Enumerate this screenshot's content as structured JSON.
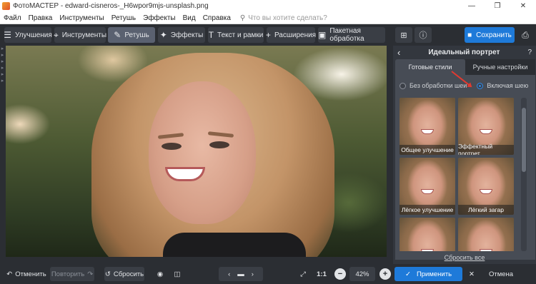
{
  "window": {
    "title": "ФотоМАСТЕР - edward-cisneros-_H6wpor9mjs-unsplash.png",
    "minimize": "—",
    "maximize": "❐",
    "close": "✕"
  },
  "menu": {
    "items": [
      "Файл",
      "Правка",
      "Инструменты",
      "Ретушь",
      "Эффекты",
      "Вид",
      "Справка"
    ],
    "search_placeholder": "Что вы хотите сделать?"
  },
  "toolbar": {
    "tools": [
      {
        "label": "Улучшения",
        "icon": "sliders-icon"
      },
      {
        "label": "Инструменты",
        "icon": "crop-icon"
      },
      {
        "label": "Ретушь",
        "icon": "brush-icon",
        "active": true
      },
      {
        "label": "Эффекты",
        "icon": "sparkle-icon"
      },
      {
        "label": "Текст и рамки",
        "icon": "text-icon"
      },
      {
        "label": "Расширения",
        "icon": "plus-icon"
      },
      {
        "label": "Пакетная обработка",
        "icon": "image-stack-icon"
      }
    ],
    "save_label": "Сохранить"
  },
  "panel": {
    "title": "Идеальный портрет",
    "help": "?",
    "tabs": [
      "Готовые стили",
      "Ручные настройки"
    ],
    "active_tab": 0,
    "radio_options": [
      "Без обработки шеи",
      "Включая шею"
    ],
    "radio_selected": 1,
    "presets": [
      "Общее улучшение",
      "Эффектный портрет",
      "Лёгкое улучшение",
      "Лёгкий загар",
      "",
      ""
    ],
    "reset_all": "Сбросить все"
  },
  "bottom": {
    "undo": "Отменить",
    "redo": "Повторить",
    "reset": "Сбросить",
    "zoom_ratio": "1:1",
    "zoom_value": "42%",
    "apply": "Применить",
    "cancel": "Отмена"
  },
  "colors": {
    "accent": "#1e7ad9",
    "background": "#2b2e33",
    "panel": "#33373e",
    "annotation_arrow": "#e23a30"
  }
}
